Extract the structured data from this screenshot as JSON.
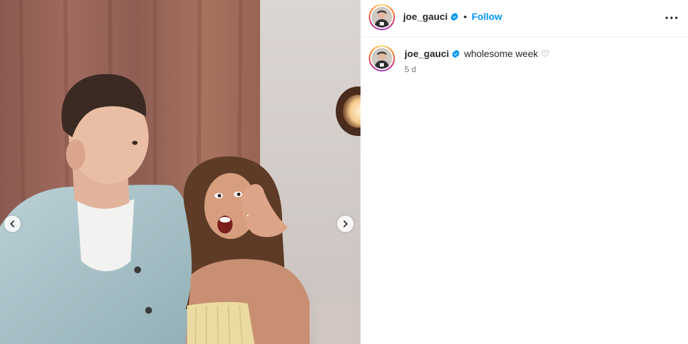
{
  "post": {
    "username": "joe_gauci",
    "verified": true,
    "follow_label": "Follow",
    "separator": "•",
    "caption_text": "wholesome week",
    "caption_emoji": "white-heart",
    "timestamp": "5 d"
  },
  "icons": {
    "prev": "chevron-left-icon",
    "next": "chevron-right-icon",
    "more": "more-horizontal-icon",
    "verified": "verified-badge-icon"
  },
  "colors": {
    "accent": "#0095f6",
    "text": "#262626",
    "muted": "#737373",
    "divider": "#efefef"
  }
}
